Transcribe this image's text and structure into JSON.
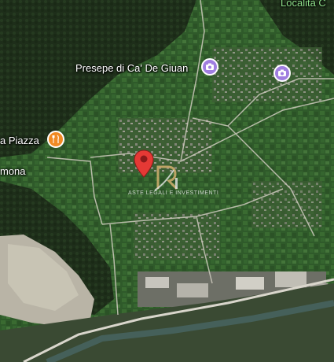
{
  "map": {
    "type": "satellite",
    "colors": {
      "poi_purple": "#a07ee0",
      "poi_orange": "#f08a24",
      "pin_red": "#e53935",
      "label_green": "#8fe08a"
    }
  },
  "places": {
    "top_right": "Località C",
    "presepe": "Presepe di Ca' De Giuan",
    "piazza": "a Piazza",
    "mona": "mona"
  },
  "pois": {
    "presepe_icon": "photo-camera-icon",
    "right_icon": "photo-camera-icon",
    "piazza_icon": "restaurant-icon"
  },
  "marker": {
    "icon": "location-pin-icon"
  },
  "watermark": {
    "text": "ASTE LEGALI E INVESTIMENTI"
  }
}
